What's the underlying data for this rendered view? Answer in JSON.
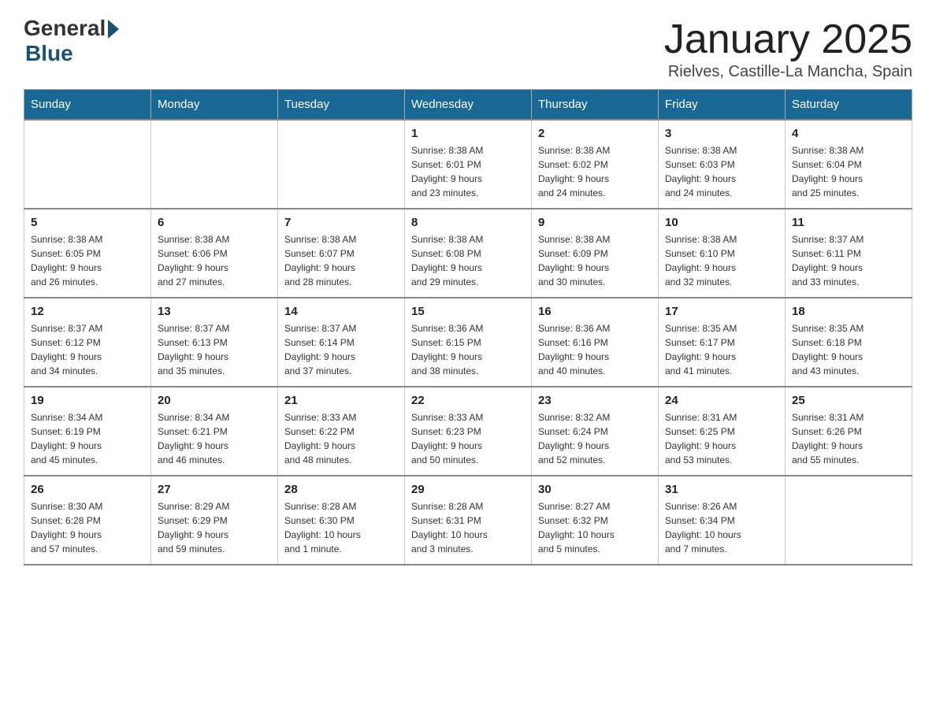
{
  "header": {
    "logo": {
      "general": "General",
      "blue": "Blue"
    },
    "title": "January 2025",
    "subtitle": "Rielves, Castille-La Mancha, Spain"
  },
  "days_of_week": [
    "Sunday",
    "Monday",
    "Tuesday",
    "Wednesday",
    "Thursday",
    "Friday",
    "Saturday"
  ],
  "weeks": [
    [
      {
        "day": "",
        "info": ""
      },
      {
        "day": "",
        "info": ""
      },
      {
        "day": "",
        "info": ""
      },
      {
        "day": "1",
        "info": "Sunrise: 8:38 AM\nSunset: 6:01 PM\nDaylight: 9 hours\nand 23 minutes."
      },
      {
        "day": "2",
        "info": "Sunrise: 8:38 AM\nSunset: 6:02 PM\nDaylight: 9 hours\nand 24 minutes."
      },
      {
        "day": "3",
        "info": "Sunrise: 8:38 AM\nSunset: 6:03 PM\nDaylight: 9 hours\nand 24 minutes."
      },
      {
        "day": "4",
        "info": "Sunrise: 8:38 AM\nSunset: 6:04 PM\nDaylight: 9 hours\nand 25 minutes."
      }
    ],
    [
      {
        "day": "5",
        "info": "Sunrise: 8:38 AM\nSunset: 6:05 PM\nDaylight: 9 hours\nand 26 minutes."
      },
      {
        "day": "6",
        "info": "Sunrise: 8:38 AM\nSunset: 6:06 PM\nDaylight: 9 hours\nand 27 minutes."
      },
      {
        "day": "7",
        "info": "Sunrise: 8:38 AM\nSunset: 6:07 PM\nDaylight: 9 hours\nand 28 minutes."
      },
      {
        "day": "8",
        "info": "Sunrise: 8:38 AM\nSunset: 6:08 PM\nDaylight: 9 hours\nand 29 minutes."
      },
      {
        "day": "9",
        "info": "Sunrise: 8:38 AM\nSunset: 6:09 PM\nDaylight: 9 hours\nand 30 minutes."
      },
      {
        "day": "10",
        "info": "Sunrise: 8:38 AM\nSunset: 6:10 PM\nDaylight: 9 hours\nand 32 minutes."
      },
      {
        "day": "11",
        "info": "Sunrise: 8:37 AM\nSunset: 6:11 PM\nDaylight: 9 hours\nand 33 minutes."
      }
    ],
    [
      {
        "day": "12",
        "info": "Sunrise: 8:37 AM\nSunset: 6:12 PM\nDaylight: 9 hours\nand 34 minutes."
      },
      {
        "day": "13",
        "info": "Sunrise: 8:37 AM\nSunset: 6:13 PM\nDaylight: 9 hours\nand 35 minutes."
      },
      {
        "day": "14",
        "info": "Sunrise: 8:37 AM\nSunset: 6:14 PM\nDaylight: 9 hours\nand 37 minutes."
      },
      {
        "day": "15",
        "info": "Sunrise: 8:36 AM\nSunset: 6:15 PM\nDaylight: 9 hours\nand 38 minutes."
      },
      {
        "day": "16",
        "info": "Sunrise: 8:36 AM\nSunset: 6:16 PM\nDaylight: 9 hours\nand 40 minutes."
      },
      {
        "day": "17",
        "info": "Sunrise: 8:35 AM\nSunset: 6:17 PM\nDaylight: 9 hours\nand 41 minutes."
      },
      {
        "day": "18",
        "info": "Sunrise: 8:35 AM\nSunset: 6:18 PM\nDaylight: 9 hours\nand 43 minutes."
      }
    ],
    [
      {
        "day": "19",
        "info": "Sunrise: 8:34 AM\nSunset: 6:19 PM\nDaylight: 9 hours\nand 45 minutes."
      },
      {
        "day": "20",
        "info": "Sunrise: 8:34 AM\nSunset: 6:21 PM\nDaylight: 9 hours\nand 46 minutes."
      },
      {
        "day": "21",
        "info": "Sunrise: 8:33 AM\nSunset: 6:22 PM\nDaylight: 9 hours\nand 48 minutes."
      },
      {
        "day": "22",
        "info": "Sunrise: 8:33 AM\nSunset: 6:23 PM\nDaylight: 9 hours\nand 50 minutes."
      },
      {
        "day": "23",
        "info": "Sunrise: 8:32 AM\nSunset: 6:24 PM\nDaylight: 9 hours\nand 52 minutes."
      },
      {
        "day": "24",
        "info": "Sunrise: 8:31 AM\nSunset: 6:25 PM\nDaylight: 9 hours\nand 53 minutes."
      },
      {
        "day": "25",
        "info": "Sunrise: 8:31 AM\nSunset: 6:26 PM\nDaylight: 9 hours\nand 55 minutes."
      }
    ],
    [
      {
        "day": "26",
        "info": "Sunrise: 8:30 AM\nSunset: 6:28 PM\nDaylight: 9 hours\nand 57 minutes."
      },
      {
        "day": "27",
        "info": "Sunrise: 8:29 AM\nSunset: 6:29 PM\nDaylight: 9 hours\nand 59 minutes."
      },
      {
        "day": "28",
        "info": "Sunrise: 8:28 AM\nSunset: 6:30 PM\nDaylight: 10 hours\nand 1 minute."
      },
      {
        "day": "29",
        "info": "Sunrise: 8:28 AM\nSunset: 6:31 PM\nDaylight: 10 hours\nand 3 minutes."
      },
      {
        "day": "30",
        "info": "Sunrise: 8:27 AM\nSunset: 6:32 PM\nDaylight: 10 hours\nand 5 minutes."
      },
      {
        "day": "31",
        "info": "Sunrise: 8:26 AM\nSunset: 6:34 PM\nDaylight: 10 hours\nand 7 minutes."
      },
      {
        "day": "",
        "info": ""
      }
    ]
  ]
}
